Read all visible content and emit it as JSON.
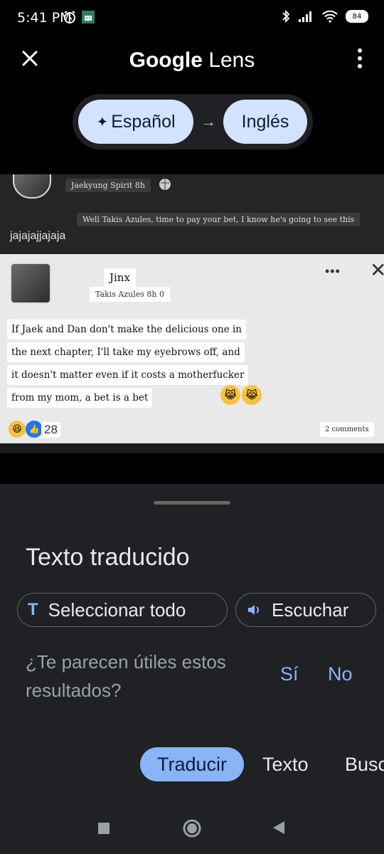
{
  "status_bar": {
    "time": "5:41 PM",
    "battery": "84"
  },
  "top_bar": {
    "title_brand": "Google",
    "title_product": "Lens"
  },
  "language": {
    "source": "Español",
    "target": "Inglés",
    "arrow": "→"
  },
  "screenshot": {
    "header_name": "Jaekyung Spirit 8h",
    "caption": "Well Takis Azules, time to pay your bet, I know he's going to see this",
    "comment_text": "jajajajjajaja",
    "post": {
      "name": "Jinx",
      "subtitle": "Takis Azules 8h 0",
      "lines": [
        "If Jaek and Dan don't make the delicious one in",
        "the next chapter, I'll take my eyebrows off, and",
        "it doesn't matter even if it costs a motherfucker",
        "from my mom, a bet is a bet"
      ],
      "reaction_count": "28",
      "comments": "2 comments"
    }
  },
  "sheet": {
    "title": "Texto traducido",
    "select_all": "Seleccionar todo",
    "listen": "Escuchar",
    "feedback_question": "¿Te parecen útiles estos resultados?",
    "yes": "Sí",
    "no": "No"
  },
  "tabs": [
    "Traducir",
    "Texto",
    "Busc"
  ],
  "colors": {
    "accent": "#8ab4f8",
    "chip_bg": "#d3e3fd",
    "sheet_bg": "#202124"
  }
}
